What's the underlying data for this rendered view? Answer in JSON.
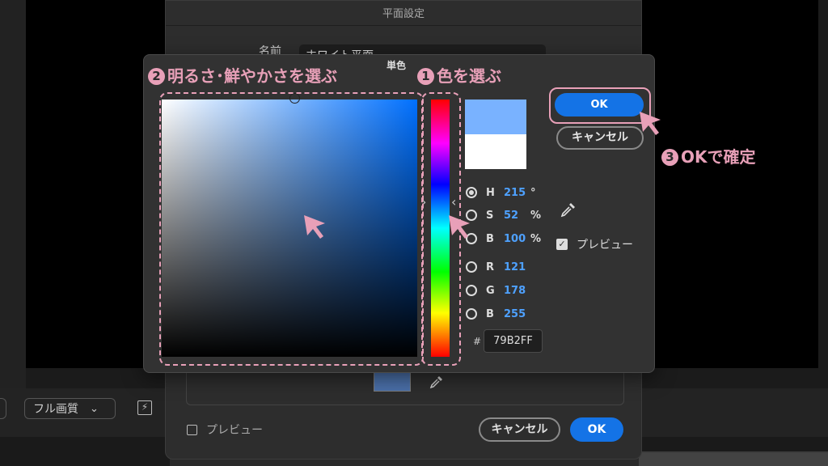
{
  "background_app": {
    "quality_label": "フル画質",
    "chevron_icon": "chevron-down-icon"
  },
  "solid_dialog": {
    "title": "平面設定",
    "name_label": "名前",
    "name_value": "ホワイト平面",
    "swatch_color": "#4a6fa8",
    "preview_label": "プレビュー",
    "cancel_label": "キャンセル",
    "ok_label": "OK"
  },
  "color_picker": {
    "title": "単色",
    "new_color": "#79b2ff",
    "old_color": "#ffffff",
    "fields": [
      {
        "label": "H",
        "value": "215",
        "unit": "°",
        "checked": true
      },
      {
        "label": "S",
        "value": "52",
        "unit": "%",
        "checked": false
      },
      {
        "label": "B",
        "value": "100",
        "unit": "%",
        "checked": false
      },
      {
        "label": "R",
        "value": "121",
        "unit": "",
        "checked": false
      },
      {
        "label": "G",
        "value": "178",
        "unit": "",
        "checked": false
      },
      {
        "label": "B",
        "value": "255",
        "unit": "",
        "checked": false
      }
    ],
    "hex_prefix": "#",
    "hex_value": "79B2FF",
    "ok_label": "OK",
    "cancel_label": "キャンセル",
    "preview_label": "プレビュー",
    "preview_checked": true
  },
  "annotations": {
    "step1_num": "1",
    "step1_text": "色を選ぶ",
    "step2_num": "2",
    "step2_text": "明るさ･鮮やかさを選ぶ",
    "step3_num": "3",
    "step3_text": "OKで確定",
    "accent_color": "#e8a0b8"
  }
}
